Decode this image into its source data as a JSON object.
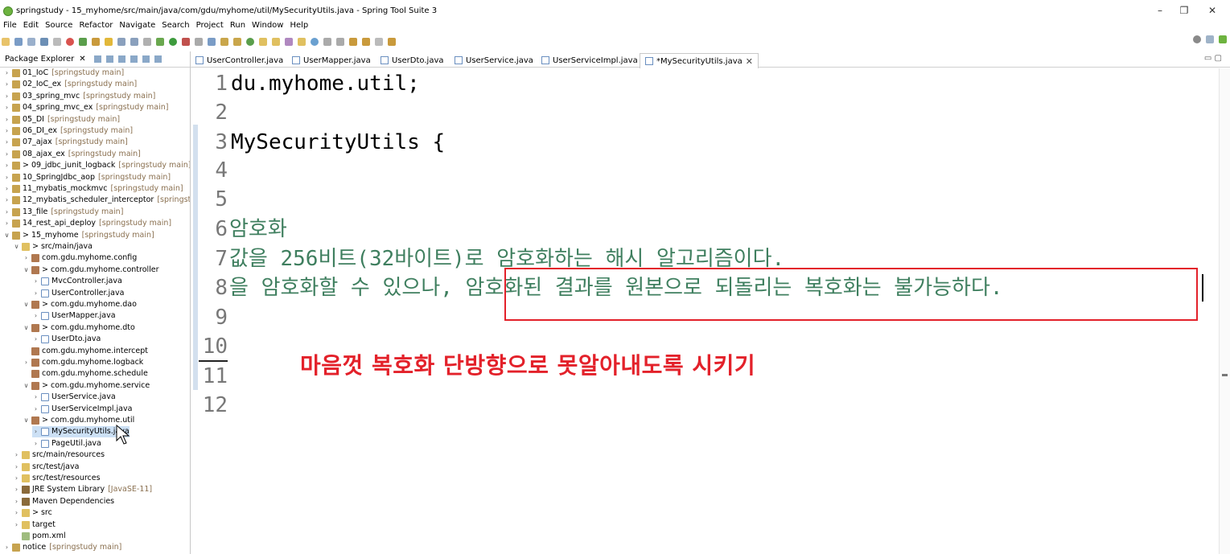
{
  "window": {
    "title": "springstudy - 15_myhome/src/main/java/com/gdu/myhome/util/MySecurityUtils.java - Spring Tool Suite 3",
    "minimize": "–",
    "restore": "❐",
    "close": "✕"
  },
  "menu": [
    "File",
    "Edit",
    "Source",
    "Refactor",
    "Navigate",
    "Search",
    "Project",
    "Run",
    "Window",
    "Help"
  ],
  "package_explorer": {
    "title": "Package Explorer",
    "close": "✕",
    "items": [
      {
        "label": "01_IoC",
        "dec": "[springstudy main]"
      },
      {
        "label": "02_IoC_ex",
        "dec": "[springstudy main]"
      },
      {
        "label": "03_spring_mvc",
        "dec": "[springstudy main]"
      },
      {
        "label": "04_spring_mvc_ex",
        "dec": "[springstudy main]"
      },
      {
        "label": "05_DI",
        "dec": "[springstudy main]"
      },
      {
        "label": "06_DI_ex",
        "dec": "[springstudy main]"
      },
      {
        "label": "07_ajax",
        "dec": "[springstudy main]"
      },
      {
        "label": "08_ajax_ex",
        "dec": "[springstudy main]"
      },
      {
        "label": "> 09_jdbc_junit_logback",
        "dec": "[springstudy main]"
      },
      {
        "label": "10_SpringJdbc_aop",
        "dec": "[springstudy main]"
      },
      {
        "label": "11_mybatis_mockmvc",
        "dec": "[springstudy main]"
      },
      {
        "label": "12_mybatis_scheduler_interceptor",
        "dec": "[springstudy"
      },
      {
        "label": "13_file",
        "dec": "[springstudy main]"
      },
      {
        "label": "14_rest_api_deploy",
        "dec": "[springstudy main]"
      },
      {
        "label": "> 15_myhome",
        "dec": "[springstudy main]"
      },
      {
        "label": "> src/main/java",
        "dec": ""
      },
      {
        "label": "com.gdu.myhome.config",
        "dec": ""
      },
      {
        "label": "> com.gdu.myhome.controller",
        "dec": ""
      },
      {
        "label": "MvcController.java",
        "dec": ""
      },
      {
        "label": "UserController.java",
        "dec": ""
      },
      {
        "label": "> com.gdu.myhome.dao",
        "dec": ""
      },
      {
        "label": "UserMapper.java",
        "dec": ""
      },
      {
        "label": "> com.gdu.myhome.dto",
        "dec": ""
      },
      {
        "label": "UserDto.java",
        "dec": ""
      },
      {
        "label": "com.gdu.myhome.intercept",
        "dec": ""
      },
      {
        "label": "com.gdu.myhome.logback",
        "dec": ""
      },
      {
        "label": "com.gdu.myhome.schedule",
        "dec": ""
      },
      {
        "label": "> com.gdu.myhome.service",
        "dec": ""
      },
      {
        "label": "UserService.java",
        "dec": ""
      },
      {
        "label": "UserServiceImpl.java",
        "dec": ""
      },
      {
        "label": "> com.gdu.myhome.util",
        "dec": ""
      },
      {
        "label": "MySecurityUtils.java",
        "dec": ""
      },
      {
        "label": "PageUtil.java",
        "dec": ""
      },
      {
        "label": "src/main/resources",
        "dec": ""
      },
      {
        "label": "src/test/java",
        "dec": ""
      },
      {
        "label": "src/test/resources",
        "dec": ""
      },
      {
        "label": "JRE System Library",
        "dec": "[JavaSE-11]"
      },
      {
        "label": "Maven Dependencies",
        "dec": ""
      },
      {
        "label": "> src",
        "dec": ""
      },
      {
        "label": "target",
        "dec": ""
      },
      {
        "label": "pom.xml",
        "dec": ""
      },
      {
        "label": "notice",
        "dec": "[springstudy main]"
      }
    ]
  },
  "tabs": [
    {
      "label": "UserController.java"
    },
    {
      "label": "UserMapper.java"
    },
    {
      "label": "UserDto.java"
    },
    {
      "label": "UserService.java"
    },
    {
      "label": "UserServiceImpl.java"
    },
    {
      "label": "*MySecurityUtils.java"
    }
  ],
  "tab_close": "✕",
  "editor": {
    "line_numbers": [
      "1",
      "2",
      "3",
      "4",
      "5",
      "6",
      "7",
      "8",
      "9",
      "10",
      "11",
      "12"
    ],
    "lines": [
      "du.myhome.util;",
      "",
      "MySecurityUtils {",
      "",
      "",
      "암호화",
      "값을 256비트(32바이트)로 암호화하는 해시 알고리즘이다.",
      "을 암호화할 수 있으나, 암호화된 결과를 원본으로 되돌리는 복호화는 불가능하다.",
      "",
      "",
      "",
      ""
    ]
  },
  "annotation": "마음껏 복호화 단방향으로 못알아내도록 시키기",
  "colors": {
    "comment": "#3f7f5f",
    "annotation_red": "#e3212a",
    "selection": "#cce0f5",
    "change_bar": "#d3e0ee"
  }
}
